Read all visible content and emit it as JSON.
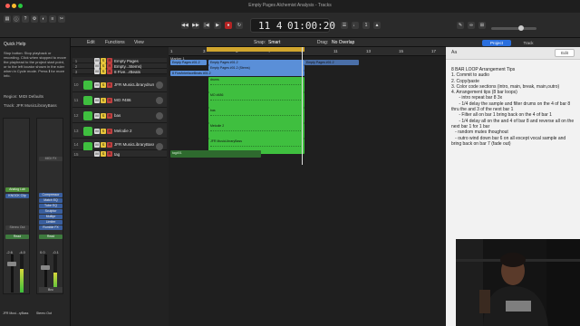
{
  "window": {
    "title": "Empty Pages Alchemist Analysis - Tracks"
  },
  "transport": {
    "bars_beats": "11 4",
    "time": "01:00:20",
    "snap_label": "Snap:",
    "snap_value": "Smart",
    "drag_label": "Drag:",
    "drag_value": "No Overlap"
  },
  "menubar": {
    "edit": "Edit",
    "functions": "Functions",
    "view": "View"
  },
  "quick_help": {
    "title": "Quick Help",
    "text": "Stop button: Stop playback or recording. Click when stopped to move the playhead to the project start point, or to the left locator shown in the ruler when in Cycle mode. Press ℹ for more info."
  },
  "inspector": {
    "region_label": "Region: MIDI Defaults",
    "track_label": "Track: JFR MusicLibraryBass",
    "strip1": {
      "slots": [
        "Analog Lab",
        "KNOCK Clip"
      ],
      "output": "Stereo Out",
      "mode": "Read",
      "vol": "-2.6",
      "pan": "-4.0",
      "name": "JFR Musi...ryBass"
    },
    "strip2": {
      "slots": [
        "MIDI FX",
        "Compressor",
        "Match EQ",
        "Tube EQ",
        "Sculptor",
        "Multipr",
        "Limiter",
        "Rumble FX"
      ],
      "mode": "Read",
      "vol": "0.0",
      "pan": "-0.1",
      "name": "Stereo Out",
      "bottom": "Bnc"
    }
  },
  "tracks": [
    {
      "num": "1",
      "name": "Empty Pages",
      "color": "#5a8fd8"
    },
    {
      "num": "2",
      "name": "Empty...Stems)",
      "color": "#5a8fd8"
    },
    {
      "num": "3",
      "name": "8 Five...rBeats",
      "color": "#5a8fd8"
    },
    {
      "num": "10",
      "name": "JFR MusicLibrarydrums",
      "color": "#3fbf3f"
    },
    {
      "num": "11",
      "name": "MO #486",
      "color": "#3fbf3f"
    },
    {
      "num": "12",
      "name": "bas",
      "color": "#3fbf3f"
    },
    {
      "num": "13",
      "name": "Melodie 2",
      "color": "#3fbf3f"
    },
    {
      "num": "14",
      "name": "JFR MusicLibraryBass",
      "color": "#3fbf3f"
    },
    {
      "num": "15",
      "name": "tag",
      "color": "#3fbf3f"
    }
  ],
  "ruler": {
    "marks": [
      "1",
      "3",
      "5",
      "7",
      "9",
      "11",
      "13",
      "15",
      "17",
      "19"
    ]
  },
  "regions": {
    "marker": "Marker 1",
    "r1": "Empty Pages #01.2",
    "r2": "Empty Pages #01.2 (Stems)",
    "r3": "8 Five/interfaceBeats #01.2",
    "r4": "Empty Pages #01.2",
    "drums": "drums",
    "mo": "MO #486",
    "bas": "bas",
    "melodie": "Melodie 2",
    "bass": "JFR MusicLibraryBass",
    "tag": "tag#01"
  },
  "notes": {
    "tab_project": "Project",
    "tab_track": "Track",
    "edit_button": "Edit",
    "format_label": "Aa",
    "body": "8 BAR LOOP Arrangement Tips\n1. Commit to audio\n2. Copy/paste\n3. Color code sections (intro, main, break, main,outro)\n4. Arrangement tips (8 bar loops)\n      - intro repeat bar 8 3x\n      - 1/4 delay the sample and filter drums on the 4 of bar 8 thru the and 3 of the next bar 1\n      - Filter all on bar 1 bring back on the 4 of bar 1\n      - 1/4 delay all on the and 4 of bar 8 and reverse all on the next bar 1 for 1 bar\n   - random mutes thoughout\n   - outro wind down bar 6 on all except vocal sample and bring back on bar 7 (fade out)"
  },
  "colors": {
    "accent_blue": "#2a6fde",
    "region_green": "#3fbf3f",
    "region_blue": "#5a8fd8",
    "lcd_yellow": "#e8b42a"
  }
}
